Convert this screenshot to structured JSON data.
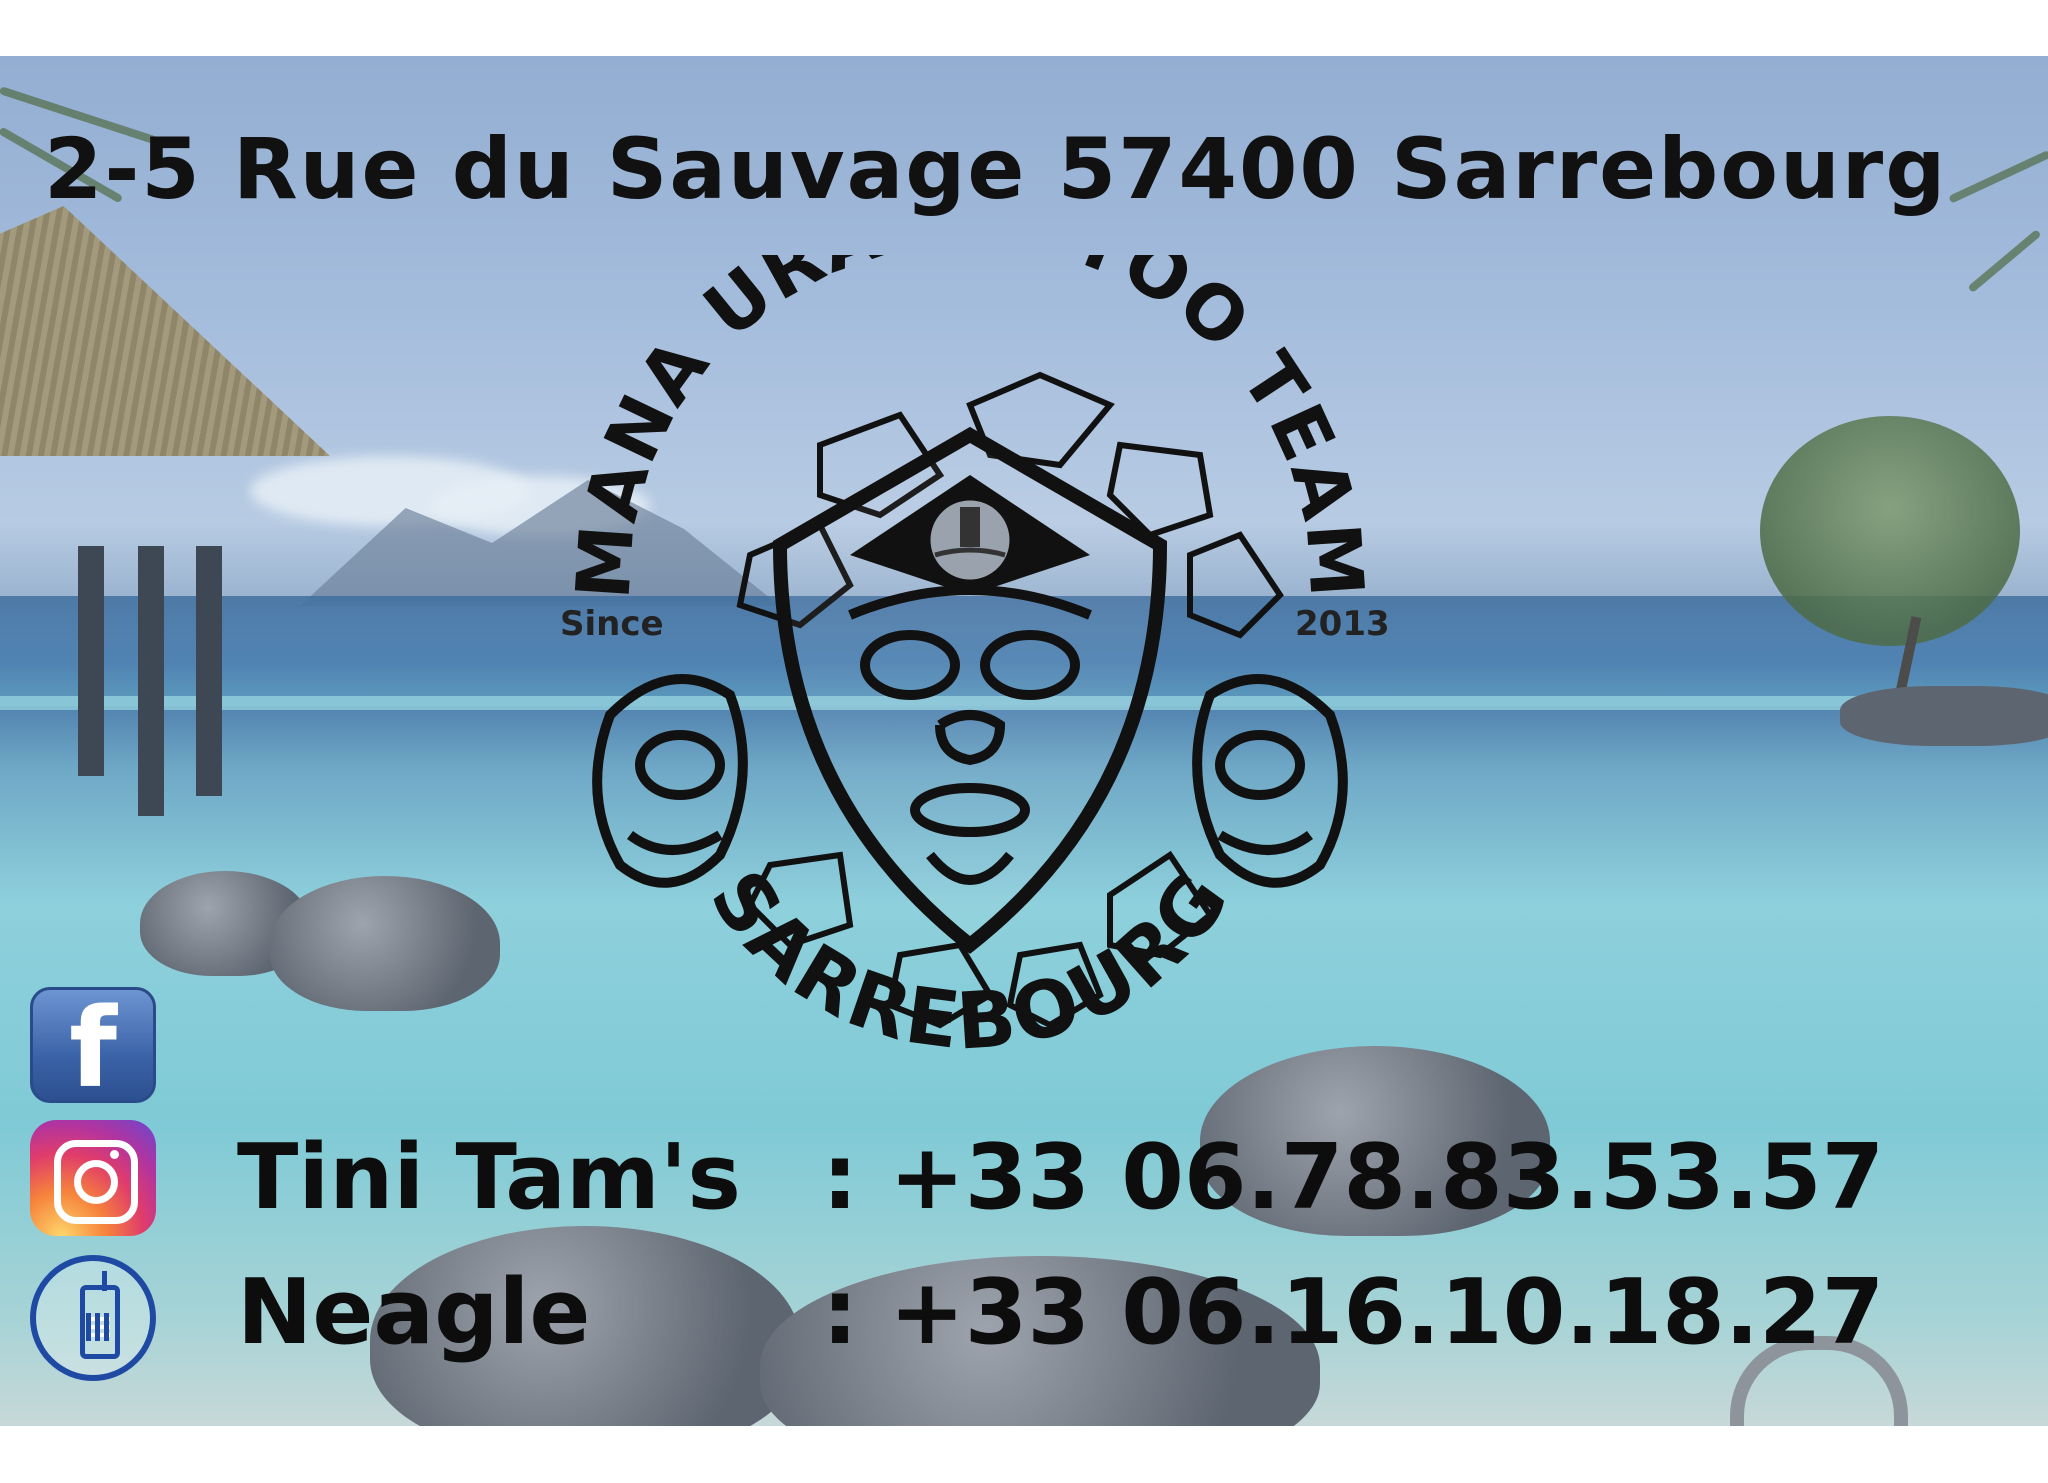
{
  "address": "2-5 Rue du Sauvage 57400 Sarrebourg",
  "logo": {
    "arc_top": "MANA URA TATTOO TEAM",
    "arc_bottom": "SARREBOURG",
    "since_label": "Since",
    "since_year": "2013"
  },
  "social": {
    "facebook_glyph": "f",
    "facebook_icon": "facebook-icon",
    "instagram_icon": "instagram-icon",
    "phone_icon": "mobile-phone-icon"
  },
  "contacts": [
    {
      "name": "Tini Tam's",
      "phone": ": +33 06.78.83.53.57"
    },
    {
      "name": "Neagle",
      "phone": ": +33 06.16.10.18.27"
    }
  ],
  "colors": {
    "text": "#111111",
    "facebook_blue": "#3b63a8",
    "phone_blue": "#1f4aa3"
  }
}
